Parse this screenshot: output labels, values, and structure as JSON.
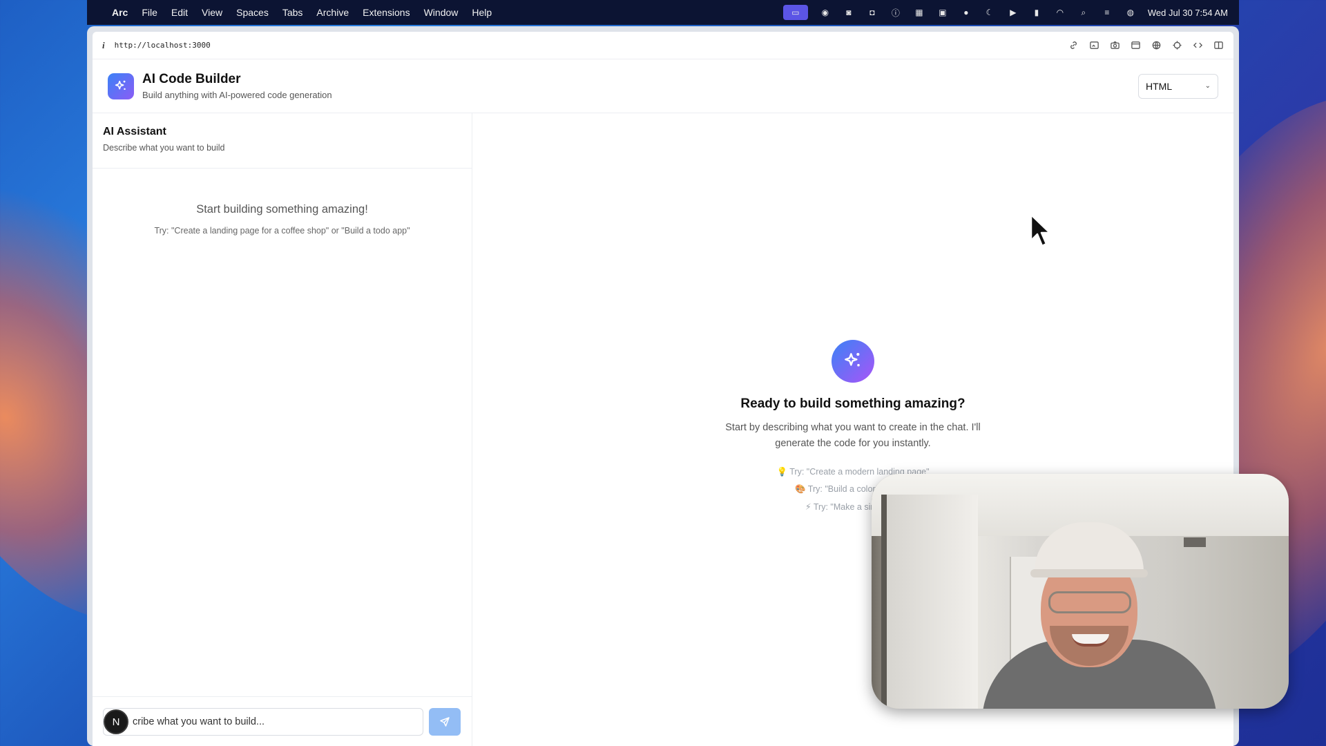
{
  "menubar": {
    "app": "Arc",
    "items": [
      "File",
      "Edit",
      "View",
      "Spaces",
      "Tabs",
      "Archive",
      "Extensions",
      "Window",
      "Help"
    ],
    "clock": "Wed Jul 30  7:54 AM"
  },
  "browser": {
    "url": "http://localhost:3000"
  },
  "header": {
    "title": "AI Code Builder",
    "subtitle": "Build anything with AI-powered code generation",
    "language": "HTML"
  },
  "chat": {
    "title": "AI Assistant",
    "subtitle": "Describe what you want to build",
    "empty_title": "Start building something amazing!",
    "empty_hint": "Try: \"Create a landing page for a coffee shop\" or \"Build a todo app\"",
    "input_value": "cribe what you want to build...",
    "avatar_letter": "N"
  },
  "preview": {
    "title": "Ready to build something amazing?",
    "description": "Start by describing what you want to create in the chat. I'll generate the code for you instantly.",
    "suggestions": [
      "💡 Try: \"Create a modern landing page\"",
      "🎨 Try: \"Build a colorful button",
      "⚡ Try: \"Make a simple ca"
    ]
  },
  "colors": {
    "accent_start": "#3b82f6",
    "accent_end": "#8b5cf6",
    "send_button": "#93bdf5"
  }
}
